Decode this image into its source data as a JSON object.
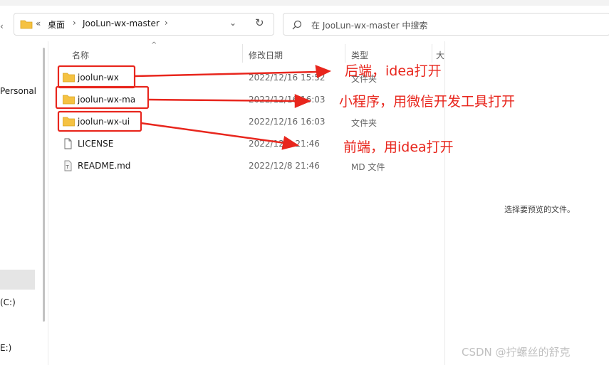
{
  "address": {
    "overflow": "«",
    "crumbs": [
      "桌面",
      "JooLun-wx-master"
    ]
  },
  "search": {
    "placeholder": "在 JooLun-wx-master 中搜索"
  },
  "nav": {
    "personal": "Personal",
    "drive_c": "(C:)",
    "drive_e": "E:)"
  },
  "columns": {
    "name": "名称",
    "date": "修改日期",
    "type": "类型",
    "size": "大"
  },
  "files": [
    {
      "name": "joolun-wx",
      "date": "2022/12/16 15:52",
      "type": "文件夹",
      "icon": "folder-icon"
    },
    {
      "name": "joolun-wx-ma",
      "date": "2022/12/16 16:03",
      "type": "",
      "icon": "folder-icon"
    },
    {
      "name": "joolun-wx-ui",
      "date": "2022/12/16 16:03",
      "type": "文件夹",
      "icon": "folder-icon"
    },
    {
      "name": "LICENSE",
      "date": "2022/12/8 21:46",
      "type": "",
      "icon": "file-icon"
    },
    {
      "name": "README.md",
      "date": "2022/12/8 21:46",
      "type": "MD 文件",
      "icon": "text-file-icon"
    }
  ],
  "preview": {
    "empty_text": "选择要预览的文件。"
  },
  "annotations": {
    "backend": "后端，idea打开",
    "miniprogram": "小程序，用微信开发工具打开",
    "frontend": "前端，用idea打开"
  },
  "watermark": "CSDN @拧螺丝的舒克",
  "colors": {
    "annotation": "#e8261d",
    "folder": "#f5c242",
    "selection": "#e5e5e5"
  }
}
